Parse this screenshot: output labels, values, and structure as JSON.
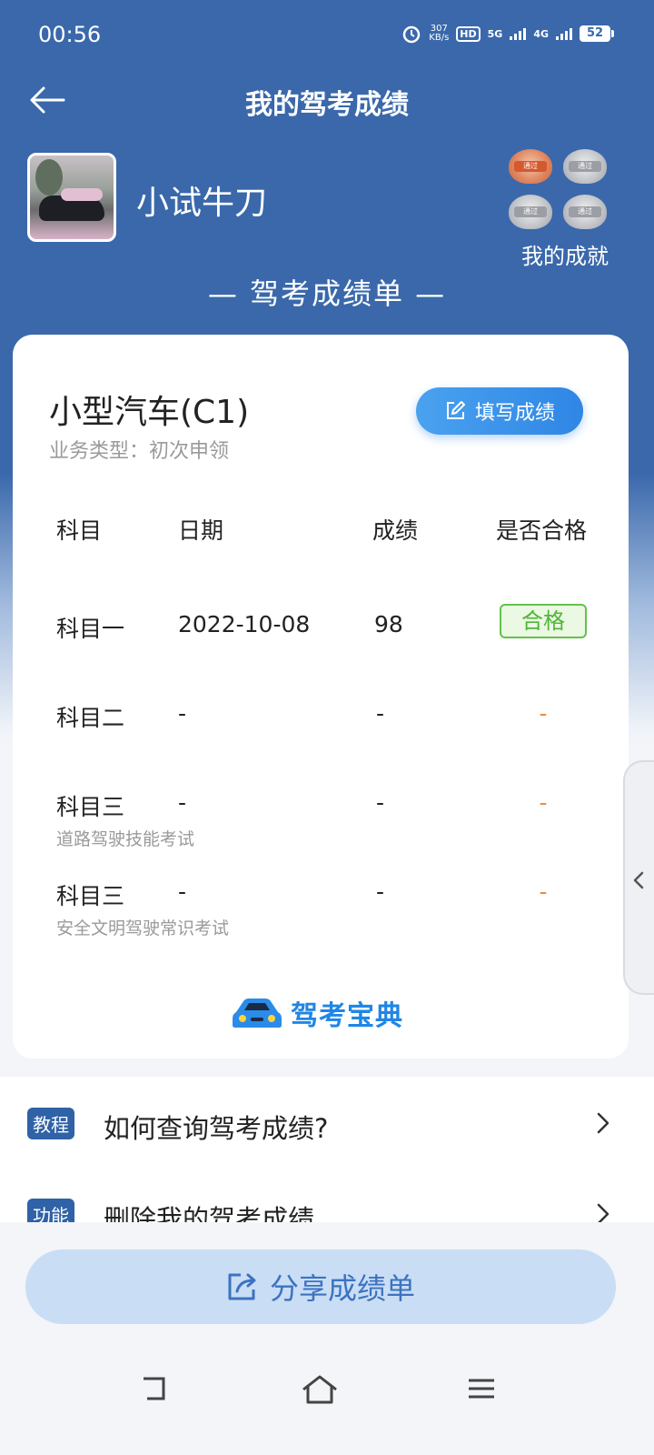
{
  "status_bar": {
    "time": "00:56",
    "net_speed_value": "307",
    "net_speed_unit": "KB/s",
    "hd": "HD",
    "sim1": "5G",
    "sim2": "4G",
    "battery": "52"
  },
  "header": {
    "title": "我的驾考成绩"
  },
  "profile": {
    "nickname": "小试牛刀",
    "achievements_label": "我的成就",
    "medal_text": "通过"
  },
  "sheet_title": "— 驾考成绩单 —",
  "card": {
    "vehicle_type": "小型汽车(C1)",
    "business_type": "业务类型：初次申领",
    "fill_button": "填写成绩",
    "columns": [
      "科目",
      "日期",
      "成绩",
      "是否合格"
    ],
    "rows": [
      {
        "subject": "科目一",
        "subtitle": "",
        "date": "2022-10-08",
        "score": "98",
        "result": "合格"
      },
      {
        "subject": "科目二",
        "subtitle": "",
        "date": "-",
        "score": "-",
        "result": "-"
      },
      {
        "subject": "科目三",
        "subtitle": "道路驾驶技能考试",
        "date": "-",
        "score": "-",
        "result": "-"
      },
      {
        "subject": "科目三",
        "subtitle": "安全文明驾驶常识考试",
        "date": "-",
        "score": "-",
        "result": "-"
      }
    ],
    "logo_text": "驾考宝典"
  },
  "list": [
    {
      "tag": "教程",
      "text": "如何查询驾考成绩?"
    },
    {
      "tag": "功能",
      "text": "删除我的驾考成绩"
    }
  ],
  "share_button": "分享成绩单",
  "colors": {
    "header_blue": "#3a68ab",
    "button_blue": "#2f86e5",
    "pass_green": "#52b536",
    "dash_orange": "#f08a3c"
  }
}
